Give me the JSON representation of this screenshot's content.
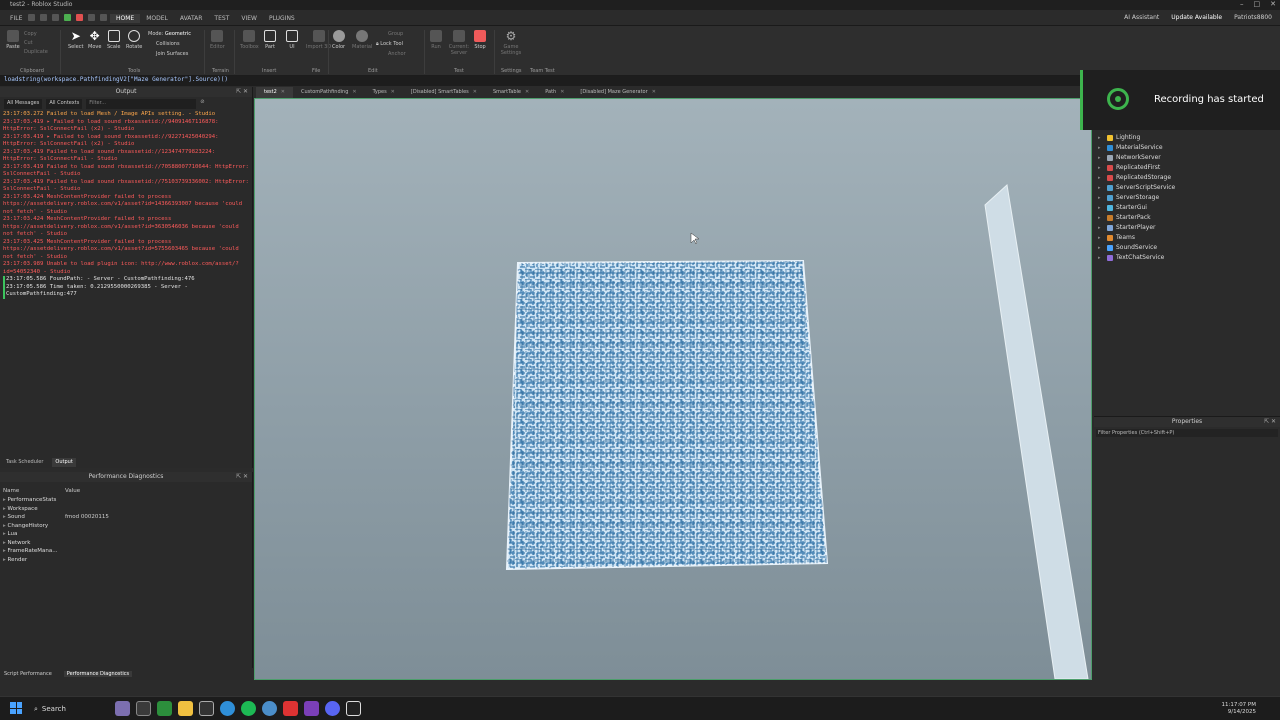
{
  "window": {
    "title": "test2 - Roblox Studio",
    "controls": [
      "–",
      "□",
      "✕"
    ]
  },
  "menu": {
    "items": [
      "FILE",
      "HOME",
      "MODEL",
      "AVATAR",
      "TEST",
      "VIEW",
      "PLUGINS"
    ],
    "active": "HOME"
  },
  "topright": {
    "assistant": "AI Assistant",
    "update": "Update Available",
    "user": "Patriots8800"
  },
  "ribbon": {
    "clipboard": [
      "Paste",
      "Copy",
      "Cut",
      "Duplicate"
    ],
    "tools": [
      "Select",
      "Move",
      "Scale",
      "Rotate"
    ],
    "mode_label": "Mode:",
    "mode_value": "Geometric",
    "collisions": "Collisions",
    "join_surfaces": "Join Surfaces",
    "terrain": "Editor",
    "toolbox": "Toolbox",
    "part": "Part",
    "ui": "UI",
    "import3d": "Import 3D",
    "color": "Color",
    "material": "Material",
    "group": "Group",
    "lock_tool": "Lock Tool",
    "anchor": "Anchor",
    "run": "Run",
    "current_client": "Current: Server",
    "stop": "Stop",
    "game_settings": "Game Settings",
    "groups": [
      "Clipboard",
      "Tools",
      "Terrain",
      "Insert",
      "File",
      "Edit",
      "Test",
      "Settings",
      "Team Test"
    ]
  },
  "command_bar": "loadstring(workspace.PathfindingV2[\"Maze Generator\"].Source)()",
  "file_tabs": [
    "test2",
    "CustomPathfinding",
    "Types",
    "[Disabled] SmartTables",
    "SmartTable",
    "Path",
    "[Disabled] Maze Generator"
  ],
  "output": {
    "title": "Output",
    "filter_messages": "All Messages",
    "filter_contexts": "All Contexts",
    "filter_placeholder": "Filter...",
    "lines": [
      {
        "t": "warn",
        "text": "23:17:03.272  Failed to load Mesh / Image APIs setting.  -  Studio"
      },
      {
        "t": "err",
        "text": "23:17:03.419  ▸ Failed to load sound rbxassetid://94091467116878: HttpError: SslConnectFail (x2)  -  Studio"
      },
      {
        "t": "err",
        "text": "23:17:03.419  ▸ Failed to load sound rbxassetid://92271425040294: HttpError: SslConnectFail (x2)  -  Studio"
      },
      {
        "t": "err",
        "text": "23:17:03.419  Failed to load sound rbxassetid://123474779823224: HttpError: SslConnectFail  -  Studio"
      },
      {
        "t": "err",
        "text": "23:17:03.419  Failed to load sound rbxassetid://70588007710644: HttpError: SslConnectFail  -  Studio"
      },
      {
        "t": "err",
        "text": "23:17:03.419  Failed to load sound rbxassetid://75103739336002: HttpError: SslConnectFail  -  Studio"
      },
      {
        "t": "err",
        "text": "23:17:03.424  MeshContentProvider failed to process https://assetdelivery.roblox.com/v1/asset?id=14366393007 because 'could not fetch'  -  Studio"
      },
      {
        "t": "err",
        "text": "23:17:03.424  MeshContentProvider failed to process https://assetdelivery.roblox.com/v1/asset?id=3630546036 because 'could not fetch'  -  Studio"
      },
      {
        "t": "err",
        "text": "23:17:03.425  MeshContentProvider failed to process https://assetdelivery.roblox.com/v1/asset?id=5755603465 because 'could not fetch'  -  Studio"
      },
      {
        "t": "err",
        "text": "23:17:03.989  Unable to load plugin icon: http://www.roblox.com/asset/?id=54052340  -  Studio"
      },
      {
        "t": "ok",
        "text": "23:17:05.586  FoundPath:  -  Server - CustomPathfinding:476"
      },
      {
        "t": "ok",
        "text": "23:17:05.586  Time taken: 0.2129550000269385  -  Server - CustomPathfinding:477"
      }
    ]
  },
  "output_tabs": [
    "Task Scheduler",
    "Output"
  ],
  "perf": {
    "title": "Performance Diagnostics",
    "columns": [
      "Name",
      "Value"
    ],
    "rows": [
      {
        "name": "PerformanceStats",
        "value": ""
      },
      {
        "name": "Workspace",
        "value": ""
      },
      {
        "name": "Sound",
        "value": "fmod 00020115"
      },
      {
        "name": "ChangeHistory",
        "value": ""
      },
      {
        "name": "Lua",
        "value": ""
      },
      {
        "name": "Network",
        "value": ""
      },
      {
        "name": "FrameRateMana...",
        "value": ""
      },
      {
        "name": "Render",
        "value": ""
      }
    ]
  },
  "status_tabs": [
    "Script Performance",
    "Performance Diagnostics"
  ],
  "explorer": {
    "items": [
      {
        "name": "Lighting",
        "color": "#f2c230"
      },
      {
        "name": "MaterialService",
        "color": "#2f8fd8"
      },
      {
        "name": "NetworkServer",
        "color": "#9aa6b4"
      },
      {
        "name": "ReplicatedFirst",
        "color": "#d94b4b"
      },
      {
        "name": "ReplicatedStorage",
        "color": "#d94b4b"
      },
      {
        "name": "ServerScriptService",
        "color": "#4fa0d0"
      },
      {
        "name": "ServerStorage",
        "color": "#4fa0d0"
      },
      {
        "name": "StarterGui",
        "color": "#4fb6e0"
      },
      {
        "name": "StarterPack",
        "color": "#c77c2b"
      },
      {
        "name": "StarterPlayer",
        "color": "#7fa6d9"
      },
      {
        "name": "Teams",
        "color": "#e28a2f"
      },
      {
        "name": "SoundService",
        "color": "#4aa3ff"
      },
      {
        "name": "TextChatService",
        "color": "#8f6dd9"
      }
    ]
  },
  "properties": {
    "title": "Properties",
    "filter": "Filter Properties (Ctrl+Shift+P)"
  },
  "toast": {
    "message": "Recording has started"
  },
  "taskbar": {
    "search": "Search",
    "time": "11:17:07 PM",
    "date": "9/14/2025"
  },
  "colors": {
    "accent": "#3db44d",
    "error": "#ff5b5b",
    "warn": "#ffa84c"
  }
}
